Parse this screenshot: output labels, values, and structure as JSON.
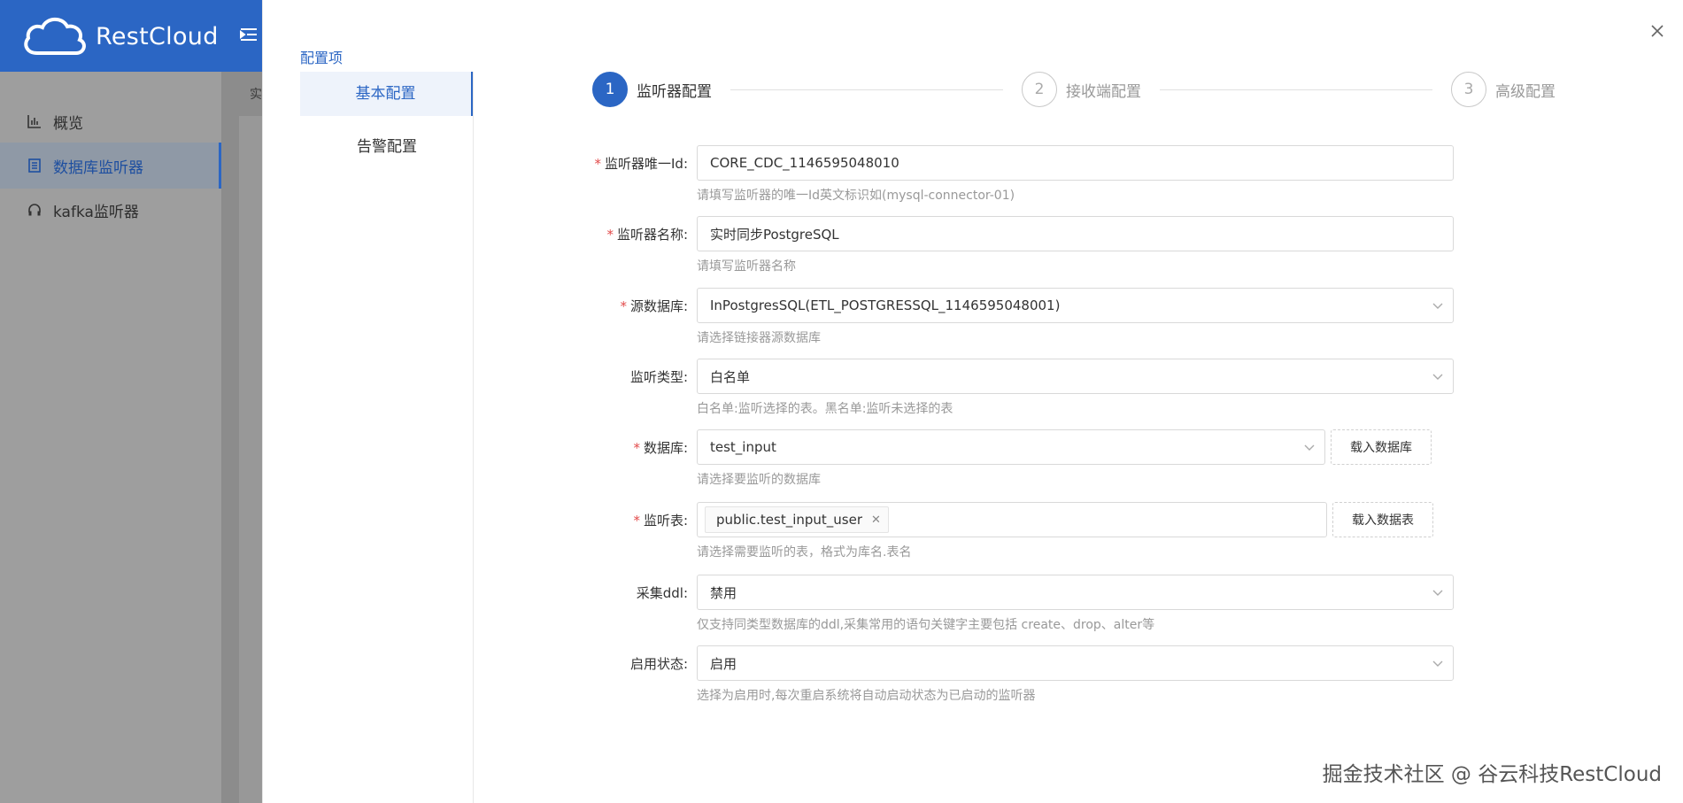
{
  "app": {
    "logo_text": "RestCloud"
  },
  "sidebar": {
    "items": [
      {
        "label": "概览"
      },
      {
        "label": "数据库监听器"
      },
      {
        "label": "kafka监听器"
      }
    ]
  },
  "background": {
    "crumb": "实"
  },
  "drawer": {
    "config_title": "配置项",
    "nav": [
      {
        "label": "基本配置"
      },
      {
        "label": "告警配置"
      }
    ],
    "steps": [
      {
        "num": "1",
        "label": "监听器配置"
      },
      {
        "num": "2",
        "label": "接收端配置"
      },
      {
        "num": "3",
        "label": "高级配置"
      }
    ],
    "form": {
      "listener_id": {
        "label": "监听器唯一Id:",
        "value": "CORE_CDC_1146595048010",
        "hint": "请填写监听器的唯一Id英文标识如(mysql-connector-01)"
      },
      "listener_name": {
        "label": "监听器名称:",
        "value": "实时同步PostgreSQL",
        "hint": "请填写监听器名称"
      },
      "source_db": {
        "label": "源数据库:",
        "value": "InPostgresSQL(ETL_POSTGRESSQL_1146595048001)",
        "hint": "请选择链接器源数据库"
      },
      "listen_type": {
        "label": "监听类型:",
        "value": "白名单",
        "hint": "白名单:监听选择的表。黑名单:监听未选择的表"
      },
      "database": {
        "label": "数据库:",
        "value": "test_input",
        "hint": "请选择要监听的数据库",
        "button": "载入数据库"
      },
      "tables": {
        "label": "监听表:",
        "tag": "public.test_input_user",
        "hint": "请选择需要监听的表，格式为库名.表名",
        "button": "载入数据表"
      },
      "collect_ddl": {
        "label": "采集ddl:",
        "value": "禁用",
        "hint": "仅支持同类型数据库的ddl,采集常用的语句关键字主要包括 create、drop、alter等"
      },
      "enable_status": {
        "label": "启用状态:",
        "value": "启用",
        "hint": "选择为启用时,每次重启系统将自动启动状态为已启动的监听器"
      }
    }
  },
  "watermark": "掘金技术社区 @ 谷云科技RestCloud",
  "colors": {
    "primary": "#2b66c4",
    "required": "#e24b4b",
    "hint": "#999999"
  }
}
